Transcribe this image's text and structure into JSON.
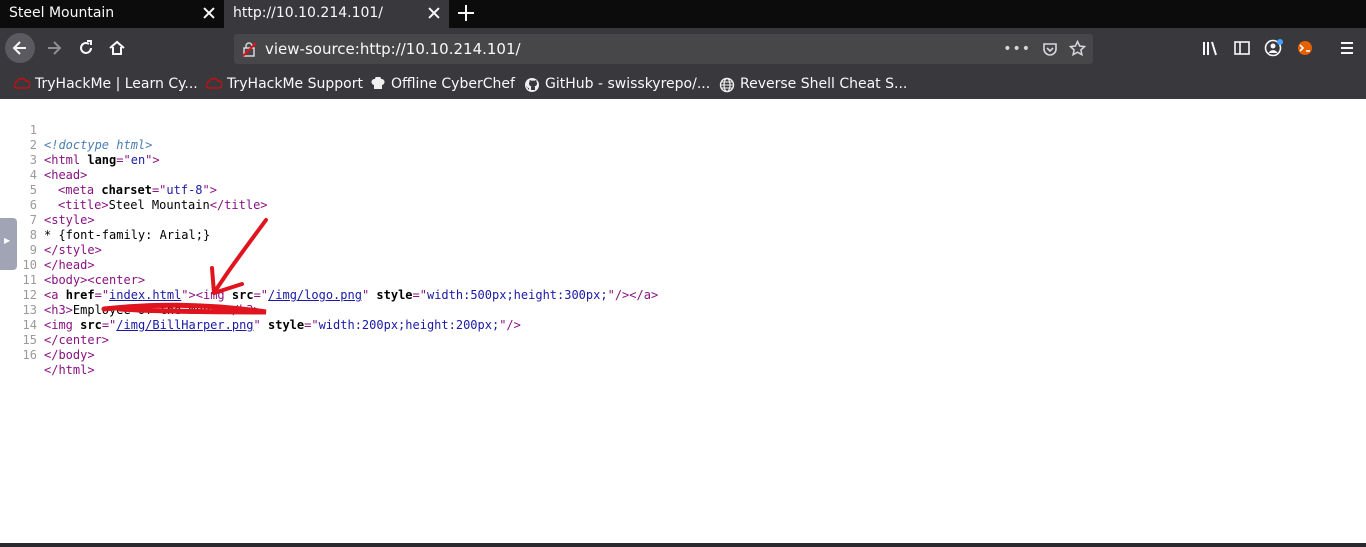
{
  "tabs": [
    {
      "title": "Steel Mountain",
      "active": false
    },
    {
      "title": "http://10.10.214.101/",
      "active": true
    }
  ],
  "url": "view-source:http://10.10.214.101/",
  "url_actions": {
    "more": "•••"
  },
  "bookmarks": [
    {
      "label": "TryHackMe | Learn Cy...",
      "icon": "tryhackme-icon"
    },
    {
      "label": "TryHackMe Support",
      "icon": "tryhackme-icon"
    },
    {
      "label": "Offline CyberChef",
      "icon": "cyberchef-icon"
    },
    {
      "label": "GitHub - swisskyrepo/...",
      "icon": "github-icon"
    },
    {
      "label": "Reverse Shell Cheat S...",
      "icon": "globe-icon"
    }
  ],
  "source": {
    "line_numbers": [
      "1",
      "2",
      "3",
      "4",
      "5",
      "6",
      "7",
      "8",
      "9",
      "10",
      "11",
      "12",
      "13",
      "14",
      "15",
      "16"
    ],
    "doctype": "<!doctype html>",
    "l2_open": "<html ",
    "l2_attr": "lang",
    "l2_eq": "=\"",
    "l2_val": "en",
    "l2_close": "\">",
    "l3": "<head>",
    "l4_open": "<meta ",
    "l4_attr": "charset",
    "l4_eq": "=\"",
    "l4_val": "utf-8",
    "l4_close": "\">",
    "l5_open": "<title>",
    "l5_text": "Steel Mountain",
    "l5_close": "</title>",
    "l6": "<style>",
    "l7": "* {font-family: Arial;}",
    "l8": "</style>",
    "l9": "</head>",
    "l10": "<body><center>",
    "l11_a": "<a ",
    "l11_href": "href",
    "l11_eq": "=\"",
    "l11_link": "index.html",
    "l11_q": "\">",
    "l11_img": "<img ",
    "l11_src": "src",
    "l11_eq2": "=\"",
    "l11_link2": "/img/logo.png",
    "l11_q2": "\" ",
    "l11_style": "style",
    "l11_eq3": "=\"",
    "l11_val3": "width:500px;height:300px;",
    "l11_end": "\"/></a>",
    "l12_open": "<h3>",
    "l12_text": "Employee of the month",
    "l12_close": "</h3>",
    "l13_img": "<img ",
    "l13_src": "src",
    "l13_eq": "=\"",
    "l13_link": "/img/BillHarper.png",
    "l13_q": "\" ",
    "l13_style": "style",
    "l13_eq2": "=\"",
    "l13_val": "width:200px;height:200px;",
    "l13_end": "\"/>",
    "l14": "</center>",
    "l15": "</body>",
    "l16": "</html>"
  },
  "colors": {
    "tab_bar": "#0c0c0d",
    "toolbar": "#38383d",
    "annotation": "#e0141e"
  }
}
